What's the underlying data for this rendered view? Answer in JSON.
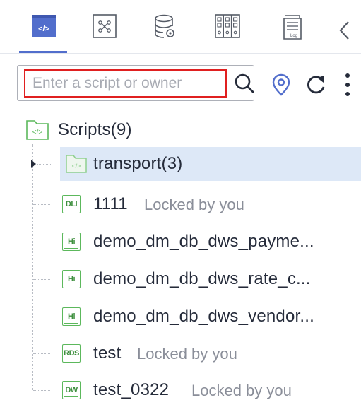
{
  "tabs": [
    {
      "name": "scripts-tab",
      "icon": "code-script-icon",
      "active": true
    },
    {
      "name": "jobs-tab",
      "icon": "workflow-nodes-icon",
      "active": false
    },
    {
      "name": "database-tab",
      "icon": "database-settings-icon",
      "active": false
    },
    {
      "name": "resources-tab",
      "icon": "resource-columns-icon",
      "active": false
    },
    {
      "name": "logs-tab",
      "icon": "log-document-icon",
      "active": false
    }
  ],
  "search": {
    "placeholder": "Enter a script or owner",
    "value": ""
  },
  "toolbar": {
    "locate_icon": "location-pin-icon",
    "refresh_icon": "refresh-icon",
    "more_icon": "more-vertical-icon"
  },
  "tree": {
    "root": {
      "label": "Scripts(9)",
      "icon": "folder-code-icon"
    },
    "items": [
      {
        "label": "transport(3)",
        "type": "folder",
        "badge": "",
        "lock": ""
      },
      {
        "label": "1111",
        "type": "DLI",
        "badge": "DLI",
        "lock": "Locked by you"
      },
      {
        "label": "demo_dm_db_dws_payme...",
        "type": "Hive",
        "badge": "Hi",
        "lock": ""
      },
      {
        "label": "demo_dm_db_dws_rate_c...",
        "type": "Hive",
        "badge": "Hi",
        "lock": ""
      },
      {
        "label": "demo_dm_db_dws_vendor...",
        "type": "Hive",
        "badge": "Hi",
        "lock": ""
      },
      {
        "label": "test",
        "type": "RDS",
        "badge": "RDS",
        "lock": "Locked by you"
      },
      {
        "label": "test_0322",
        "type": "DWS",
        "badge": "DW",
        "lock": "Locked by you"
      }
    ]
  },
  "colors": {
    "accent": "#526ecc",
    "selected_row": "#dde8f7",
    "badge_green": "#5cb85c",
    "search_highlight": "#e02020",
    "muted_text": "#8a8e99"
  }
}
